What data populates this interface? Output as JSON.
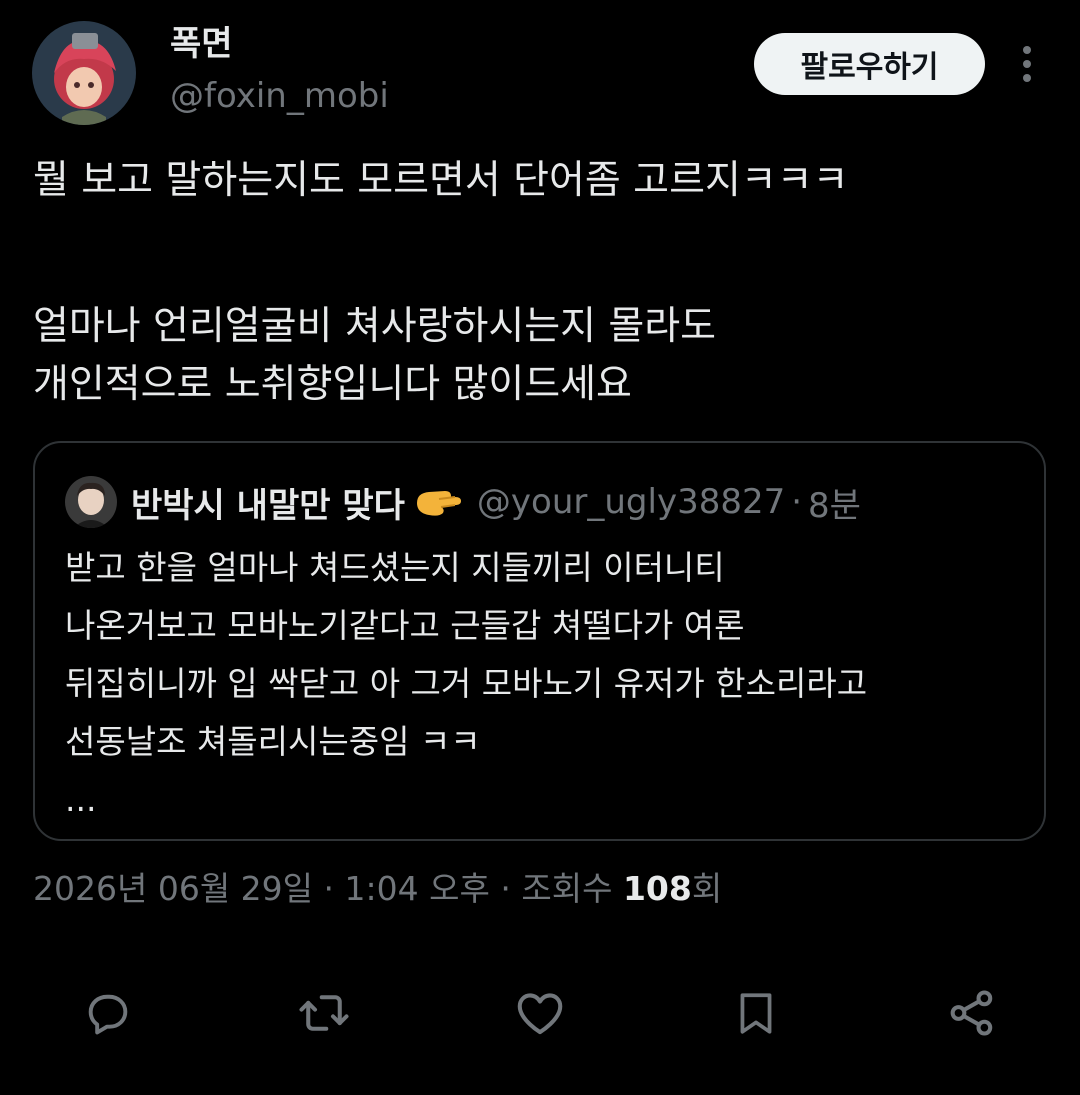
{
  "author": {
    "display_name": "폭면",
    "handle": "@foxin_mobi"
  },
  "follow_button_label": "팔로우하기",
  "tweet": {
    "lines": [
      "뭘 보고 말하는지도 모르면서 단어좀 고르지ㅋㅋㅋ",
      "얼마나 언리얼굴비 쳐사랑하시는지 몰라도",
      "개인적으로 노취향입니다 많이드세요"
    ]
  },
  "quote": {
    "display_name": "반박시 내말만 맞다",
    "handle": "@your_ugly38827",
    "separator": "·",
    "time": "8분",
    "lines": [
      "받고 한을 얼마나 쳐드셨는지 지들끼리 이터니티",
      "나온거보고 모바노기같다고 근들갑 쳐떨다가 여론",
      "뒤집히니까 입 싹닫고 아 그거 모바노기 유저가 한소리라고",
      "선동날조 쳐돌리시는중임 ㅋㅋ",
      "..."
    ]
  },
  "meta": {
    "date": "2026년 06월 29일",
    "separator": "·",
    "time": "1:04 오후",
    "views_label": "조회수",
    "views_count": "108",
    "views_suffix": "회"
  },
  "icons": {
    "reply": "reply-icon",
    "retweet": "retweet-icon",
    "like": "heart-icon",
    "bookmark": "bookmark-icon",
    "share": "share-icon",
    "more": "more-icon"
  },
  "colors": {
    "background": "#000000",
    "text_primary": "#e7e9ea",
    "text_secondary": "#71767b",
    "border": "#2f3336",
    "follow_button_bg": "#eff3f4"
  }
}
